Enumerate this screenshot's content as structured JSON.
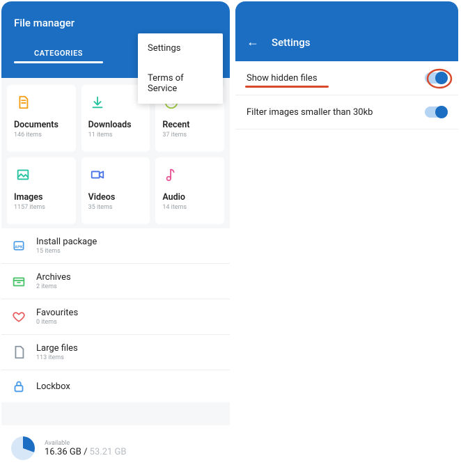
{
  "left": {
    "title": "File manager",
    "tabs": [
      "CATEGORIES",
      ""
    ],
    "menu": [
      "Settings",
      "Terms of Service"
    ],
    "cards": [
      {
        "label": "Documents",
        "sub": "146 items",
        "icon": "document",
        "color": "#f39c12"
      },
      {
        "label": "Downloads",
        "sub": "11 items",
        "icon": "download",
        "color": "#25c2a0"
      },
      {
        "label": "Recent",
        "sub": "37 items",
        "icon": "clock",
        "color": "#9ccc3c"
      },
      {
        "label": "Images",
        "sub": "1157 items",
        "icon": "image",
        "color": "#25c2a0"
      },
      {
        "label": "Videos",
        "sub": "35 items",
        "icon": "video",
        "color": "#4a74e8"
      },
      {
        "label": "Audio",
        "sub": "14 items",
        "icon": "music",
        "color": "#e85496"
      }
    ],
    "list": [
      {
        "label": "Install package",
        "sub": "15 items",
        "icon": "apk",
        "color": "#4a9be8"
      },
      {
        "label": "Archives",
        "sub": "2 items",
        "icon": "archive",
        "color": "#4bc46b"
      },
      {
        "label": "Favourites",
        "sub": "0 items",
        "icon": "heart",
        "color": "#e85a5a"
      },
      {
        "label": "Large files",
        "sub": "113 items",
        "icon": "file",
        "color": "#8a94a0"
      },
      {
        "label": "Lockbox",
        "sub": "",
        "icon": "lock",
        "color": "#4a9be8"
      }
    ],
    "storage": {
      "available_label": "Available",
      "used": "16.36 GB",
      "sep": " / ",
      "total": "53.21 GB"
    }
  },
  "right": {
    "title": "Settings",
    "rows": [
      {
        "label": "Show hidden files",
        "on": true,
        "highlight": true
      },
      {
        "label": "Filter images smaller than 30kb",
        "on": true,
        "highlight": false
      }
    ]
  }
}
